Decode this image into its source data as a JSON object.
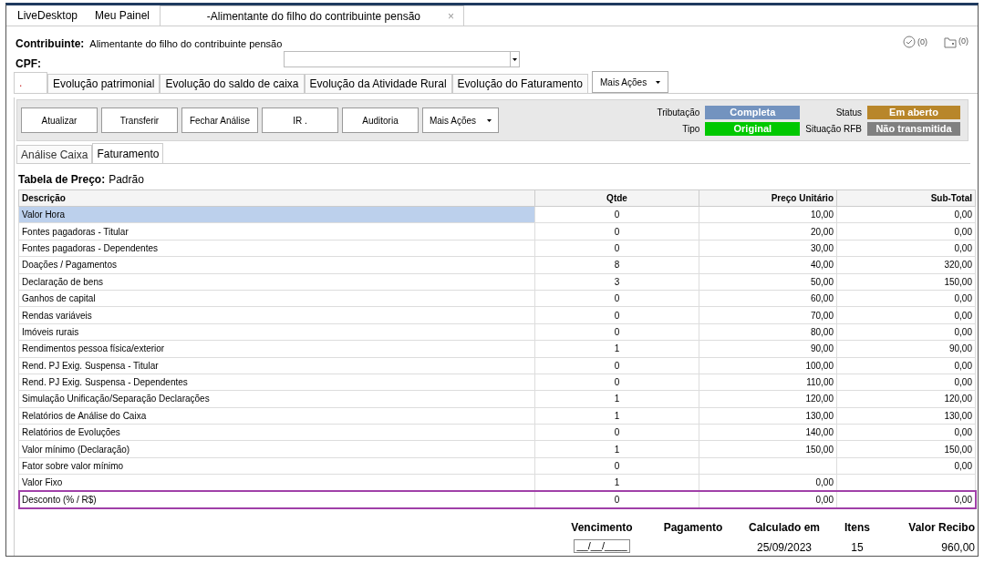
{
  "doc_tabs": [
    {
      "label": "LiveDesktop",
      "selected": false
    },
    {
      "label": "Meu Painel",
      "selected": false
    },
    {
      "label": "-Alimentante do filho do contribuinte pensão",
      "selected": true,
      "close_symbol": "×"
    }
  ],
  "header": {
    "contribuinte_label": "Contribuinte:",
    "contribuinte_value": "Alimentante do filho do contribuinte pensão",
    "cpf_label": "CPF:",
    "checks_count": "(0)",
    "files_count": "(0)"
  },
  "section_tabs": [
    {
      "label": ".",
      "selected": true
    },
    {
      "label": "Evolução patrimonial",
      "selected": false
    },
    {
      "label": "Evolução do saldo de caixa",
      "selected": false
    },
    {
      "label": "Evolução da Atividade Rural",
      "selected": false
    },
    {
      "label": "Evolução do Faturamento",
      "selected": false
    }
  ],
  "section_menu": "Mais Ações",
  "toolbar": [
    {
      "label": "Atualizar",
      "kind": "button"
    },
    {
      "label": "Transferir",
      "kind": "button"
    },
    {
      "label": "Fechar Análise",
      "kind": "button"
    },
    {
      "label": "IR .",
      "kind": "button"
    },
    {
      "label": "Auditoria",
      "kind": "button"
    },
    {
      "label": "Mais Ações",
      "kind": "menu"
    }
  ],
  "badges": [
    {
      "label": "Tributação",
      "value": "Completa",
      "color": "#7393bf"
    },
    {
      "label": "Status",
      "value": "Em aberto",
      "color": "#b8862a"
    },
    {
      "label": "Tipo",
      "value": "Original",
      "color": "#00c800"
    },
    {
      "label": "Situação RFB",
      "value": "Não transmitida",
      "color": "#808080"
    }
  ],
  "inner_tabs": [
    {
      "label": "Análise Caixa",
      "selected": false
    },
    {
      "label": "Faturamento",
      "selected": true
    }
  ],
  "price_table_label": "Tabela de Preço:",
  "price_table_value": "Padrão",
  "table": {
    "columns": [
      "Descrição",
      "Qtde",
      "Preço Unitário",
      "Sub-Total"
    ],
    "rows": [
      {
        "cells": [
          "Valor Hora",
          "0",
          "10,00",
          "0,00"
        ],
        "selected": true,
        "highlighted": false
      },
      {
        "cells": [
          "Fontes pagadoras - Titular",
          "0",
          "20,00",
          "0,00"
        ],
        "selected": false,
        "highlighted": false
      },
      {
        "cells": [
          "Fontes pagadoras - Dependentes",
          "0",
          "30,00",
          "0,00"
        ],
        "selected": false,
        "highlighted": false
      },
      {
        "cells": [
          "Doações / Pagamentos",
          "8",
          "40,00",
          "320,00"
        ],
        "selected": false,
        "highlighted": false
      },
      {
        "cells": [
          "Declaração de bens",
          "3",
          "50,00",
          "150,00"
        ],
        "selected": false,
        "highlighted": false
      },
      {
        "cells": [
          "Ganhos de capital",
          "0",
          "60,00",
          "0,00"
        ],
        "selected": false,
        "highlighted": false
      },
      {
        "cells": [
          "Rendas variáveis",
          "0",
          "70,00",
          "0,00"
        ],
        "selected": false,
        "highlighted": false
      },
      {
        "cells": [
          "Imóveis rurais",
          "0",
          "80,00",
          "0,00"
        ],
        "selected": false,
        "highlighted": false
      },
      {
        "cells": [
          "Rendimentos pessoa física/exterior",
          "1",
          "90,00",
          "90,00"
        ],
        "selected": false,
        "highlighted": false
      },
      {
        "cells": [
          "Rend. PJ Exig. Suspensa - Titular",
          "0",
          "100,00",
          "0,00"
        ],
        "selected": false,
        "highlighted": false
      },
      {
        "cells": [
          "Rend. PJ Exig. Suspensa - Dependentes",
          "0",
          "110,00",
          "0,00"
        ],
        "selected": false,
        "highlighted": false
      },
      {
        "cells": [
          "Simulação Unificação/Separação Declarações",
          "1",
          "120,00",
          "120,00"
        ],
        "selected": false,
        "highlighted": false
      },
      {
        "cells": [
          "Relatórios de Análise do Caixa",
          "1",
          "130,00",
          "130,00"
        ],
        "selected": false,
        "highlighted": false
      },
      {
        "cells": [
          "Relatórios de Evoluções",
          "0",
          "140,00",
          "0,00"
        ],
        "selected": false,
        "highlighted": false
      },
      {
        "cells": [
          "Valor mínimo (Declaração)",
          "1",
          "150,00",
          "150,00"
        ],
        "selected": false,
        "highlighted": false
      },
      {
        "cells": [
          "Fator sobre valor mínimo",
          "0",
          "",
          "0,00"
        ],
        "selected": false,
        "highlighted": false
      },
      {
        "cells": [
          "Valor Fixo",
          "1",
          "0,00",
          ""
        ],
        "selected": false,
        "highlighted": false
      },
      {
        "cells": [
          "Desconto (% / R$)",
          "0",
          "0,00",
          "0,00"
        ],
        "selected": false,
        "highlighted": true
      }
    ]
  },
  "footer": {
    "columns": [
      "Vencimento",
      "Pagamento",
      "Calculado em",
      "Itens",
      "Valor Recibo"
    ],
    "vencimento_placeholder": "__/__/____",
    "calculado_em": "25/09/2023",
    "itens": "15",
    "valor_recibo": "960,00"
  }
}
